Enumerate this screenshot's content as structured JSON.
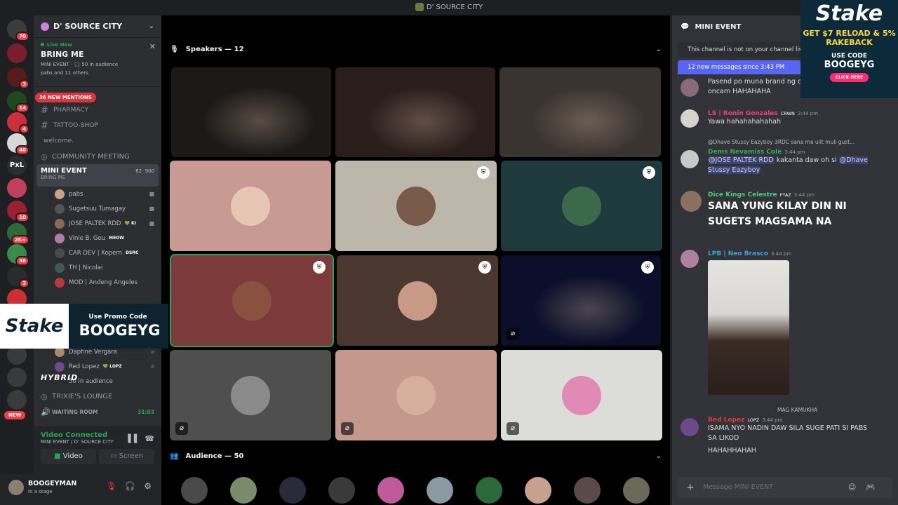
{
  "window": {
    "title": "D' SOURCE CITY"
  },
  "rail": {
    "servers": [
      {
        "badge": "70",
        "color": "#3c3c3c"
      },
      {
        "badge": "",
        "color": "#7a1e2e"
      },
      {
        "badge": "3",
        "color": "#5a1a1a"
      },
      {
        "badge": "14",
        "color": "#1d4a1d"
      },
      {
        "badge": "4",
        "color": "#c9303a"
      },
      {
        "badge": "46",
        "color": "#d8d8d8"
      },
      {
        "badge": "",
        "color": "#2b2d31"
      },
      {
        "badge": "",
        "color": "#c0405a"
      },
      {
        "badge": "10",
        "color": "#9a2030"
      },
      {
        "badge": "2K+",
        "color": "#2d6a3a"
      },
      {
        "badge": "36",
        "color": "#3a8a4a"
      },
      {
        "badge": "3",
        "color": "#2b2b2b"
      },
      {
        "badge": "",
        "color": "#cc2f2f"
      }
    ],
    "pxl_label": "PxL",
    "new_label": "NEW"
  },
  "sidebar": {
    "server_name": "D' SOURCE CITY",
    "live": {
      "tag": "Live Now",
      "title": "BRING ME",
      "info": "MINI EVENT · 🎧 50 in audience",
      "others": "pabs and 11 others"
    },
    "mentions": "36 NEW MENTIONS",
    "text_channels": [
      {
        "name": ""
      },
      {
        "name": "PHARMACY"
      },
      {
        "name": "TATTOO-SHOP"
      }
    ],
    "welcome": "welcome.",
    "community": "COMMUNITY MEETING",
    "active": {
      "name": "MINI EVENT",
      "sub": "BRING ME",
      "count_a": "62",
      "count_b": "900"
    },
    "members": [
      {
        "name": "pabs",
        "tag": "",
        "color": "#c8a488"
      },
      {
        "name": "Sugetsuu Tumagay",
        "tag": "",
        "color": "#555"
      },
      {
        "name": "JOSE PALTEK RDD",
        "tag": "💚 KI",
        "color": "#8b6a5a"
      },
      {
        "name": "Vinie B. Gou",
        "tag": "MEOW",
        "color": "#b57cab"
      },
      {
        "name": "CAR DEV | Kopern",
        "tag": "DSRC",
        "color": "#4a4a4a"
      },
      {
        "name": "TH | Nicolai",
        "tag": "",
        "color": "#3e5a4a"
      },
      {
        "name": "MOD | Andeng Angeles",
        "tag": "",
        "color": "#b43b3b"
      }
    ],
    "members2": [
      {
        "name": "Daphne Vergara",
        "tag": "",
        "color": "#a88b6c"
      },
      {
        "name": "Red Lopez",
        "tag": "💚 LOPZ",
        "color": "#6a4a8a"
      }
    ],
    "audience": "50 in audience",
    "lounge": "TRIXIE'S LOUNGE",
    "waiting": "WAITING ROOM",
    "waiting_time": "31:03",
    "promo": {
      "logo": "Stake",
      "line1": "Use Promo Code",
      "code": "BOOGEYG"
    },
    "hybrid": "HYBRID"
  },
  "voice": {
    "status": "Video Connected",
    "location": "MINI EVENT / D' SOURCE CITY",
    "video_label": "Video",
    "screen_label": "Screen"
  },
  "user": {
    "name": "BOOGEYMAN",
    "status": "In a stage"
  },
  "stage": {
    "speakers_label": "Speakers — 12",
    "audience_label": "Audience — 50",
    "tiles": [
      {
        "kind": "cam",
        "color": "#1c1a18",
        "mod": false,
        "muted": false
      },
      {
        "kind": "cam",
        "color": "#2a1e1c",
        "mod": false,
        "muted": false
      },
      {
        "kind": "cam",
        "color": "#3a3430",
        "mod": false,
        "muted": false
      },
      {
        "kind": "avatar",
        "color": "#c79a93",
        "av": "#e8c6b6",
        "mod": false,
        "muted": false
      },
      {
        "kind": "avatar",
        "color": "#bdb6aa",
        "av": "#7a5a4a",
        "mod": true,
        "muted": false
      },
      {
        "kind": "avatar",
        "color": "#1e3a3c",
        "av": "#3a6a4a",
        "mod": true,
        "muted": false
      },
      {
        "kind": "avatar",
        "color": "#7d3a3a",
        "av": "#8a5040",
        "mod": true,
        "muted": false
      },
      {
        "kind": "avatar",
        "color": "#4a3830",
        "av": "#c89a86",
        "mod": true,
        "muted": false
      },
      {
        "kind": "cam",
        "color": "#0b0f2a",
        "mod": true,
        "muted": true
      },
      {
        "kind": "avatar",
        "color": "#4f4f4f",
        "av": "#8a8a8a",
        "mod": false,
        "muted": true
      },
      {
        "kind": "avatar",
        "color": "#c4988c",
        "av": "#d6b09c",
        "mod": false,
        "muted": true
      },
      {
        "kind": "avatar",
        "color": "#dcdcd8",
        "av": "#e28ab6",
        "mod": false,
        "muted": true
      }
    ],
    "audience": [
      "#4a4a4a",
      "#7a8a6a",
      "#2a2a3a",
      "#3a3a3a",
      "#c05a9a",
      "#8a9aa0",
      "#2a6a3a",
      "#c8a090",
      "#5a4a4a",
      "#6a6a5a"
    ]
  },
  "chat": {
    "channel": "MINI EVENT",
    "notice": "This channel is not on your channel list.",
    "new_messages": "12 new messages since 3:43 PM",
    "messages": [
      {
        "name": "",
        "color": "#f2f3f5",
        "time": "",
        "tag": "",
        "reply": "",
        "text": "Pasend po muna brand ng ca oncam HAHAHAHA",
        "avatar": "#8a6a7a"
      },
      {
        "name": "LS | Ronin Gonzales",
        "color": "#f23f7a",
        "time": "3:44 pm",
        "tag": "CRWN",
        "reply": "",
        "text": "Yawa hahahahahahah",
        "avatar": "#d8d4cc"
      },
      {
        "name": "Dems Nevamiss Cole",
        "color": "#3ba55c",
        "time": "3:44 pm",
        "tag": "",
        "reply": "@Dhave Stussy Eazyboy  3RDC  sana ma ulit muli gust...",
        "text_parts": [
          "@JOSE PALTEK RDD",
          " kakanta daw oh si ",
          "@Dhave Stussy Eazyboy"
        ],
        "avatar": "#c8c8c8"
      },
      {
        "name": "Dice Kings Celestre",
        "color": "#4fc97a",
        "time": "3:44 pm",
        "tag": "FYAZ",
        "reply": "",
        "big": "SANA YUNG KILAY DIN NI SUGETS MAGSAMA NA",
        "avatar": "#8a7060"
      },
      {
        "name": "LPB | Neo Brasco",
        "color": "#3fa0d8",
        "time": "3:44 pm",
        "tag": "",
        "reply": "",
        "text": "",
        "avatar": "#b080a0"
      },
      {
        "name": "Red Lopez",
        "color": "#e03a3a",
        "time": "3:44 pm",
        "tag": "LOPZ",
        "reply": "MAG KAMUKHA",
        "text": "ISAMA NYO NADIN DAW SILA SUGE PATI SI PABS SA LIKOD",
        "text2": "HAHAHHAHAH",
        "avatar": "#6a4a8a"
      }
    ],
    "input_placeholder": "Message MINI EVENT"
  },
  "ad": {
    "logo": "Stake",
    "line1": "GET $7 RELOAD & 5% RAKEBACK",
    "line2": "USE CODE",
    "code": "BOOGEYG",
    "cta": "CLICK HERE"
  },
  "icons": [
    "mic-icon",
    "chevron-down-icon",
    "headset-icon",
    "gear-icon",
    "shield-icon",
    "mic-off-icon",
    "plus-icon",
    "emoji-icon",
    "gamepad-icon",
    "hash-icon",
    "speaker-icon",
    "video-icon",
    "screen-icon",
    "close-icon"
  ]
}
